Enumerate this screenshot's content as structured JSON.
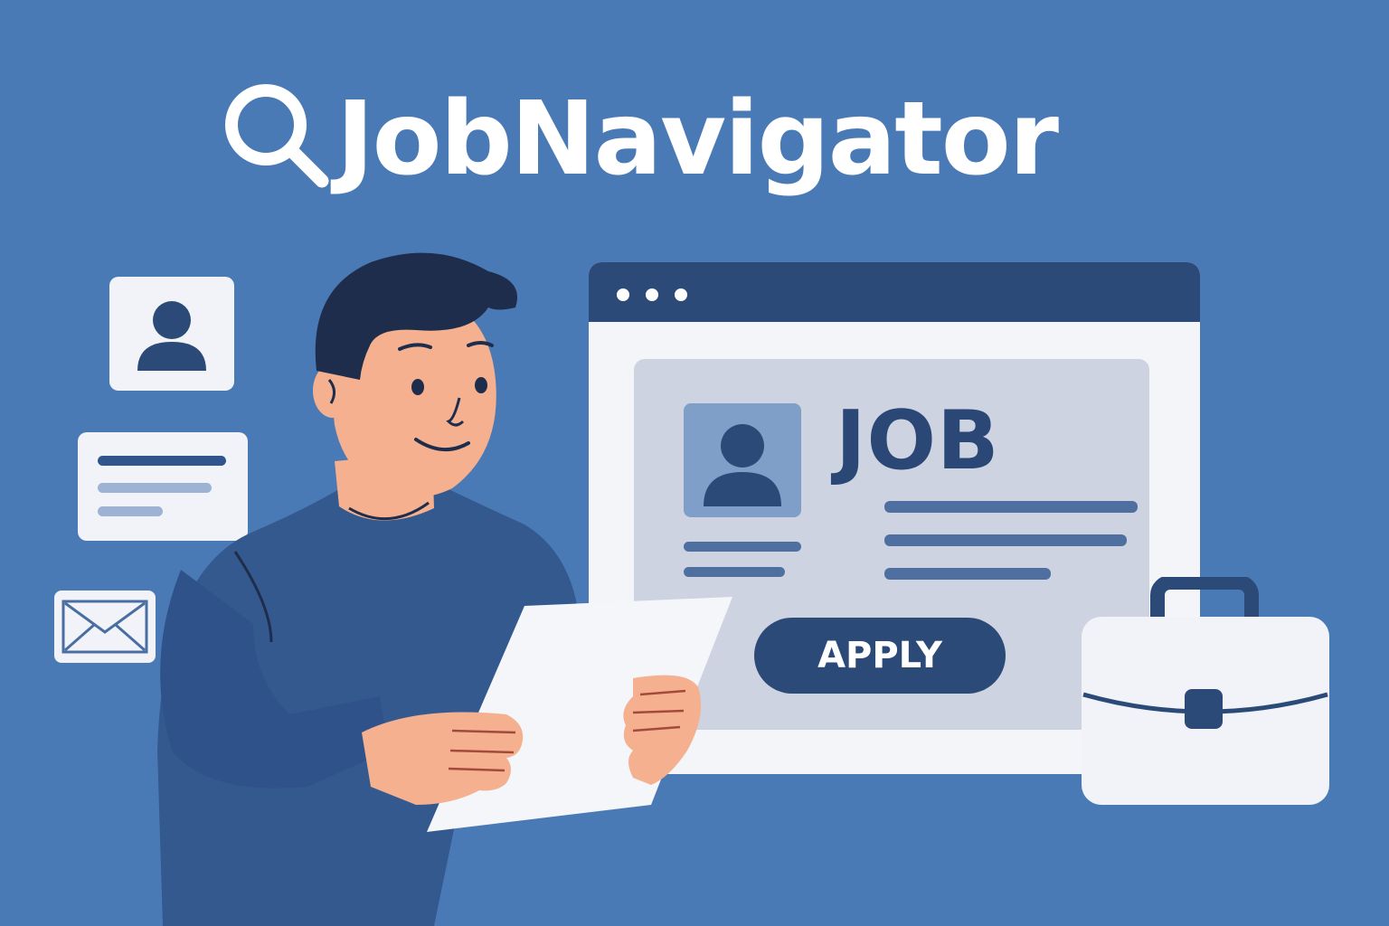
{
  "brand": {
    "name": "JobNavigator",
    "icon": "search-icon"
  },
  "job_listing": {
    "title": "JOB",
    "apply_label": "APPLY"
  },
  "side_cards": [
    {
      "icon": "user-profile-icon"
    },
    {
      "icon": "text-lines-icon"
    },
    {
      "icon": "envelope-icon"
    }
  ],
  "extras": {
    "briefcase_icon": "briefcase-icon",
    "person": "person-holding-document"
  },
  "colors": {
    "background": "#4a7ab5",
    "navy": "#2c4a78",
    "card": "#f1f3f8",
    "panel": "#cdd3e0",
    "avatar_box": "#7f9fc9",
    "skin": "#f4b08f",
    "sweater": "#34598f",
    "hair": "#1f2d4d"
  }
}
